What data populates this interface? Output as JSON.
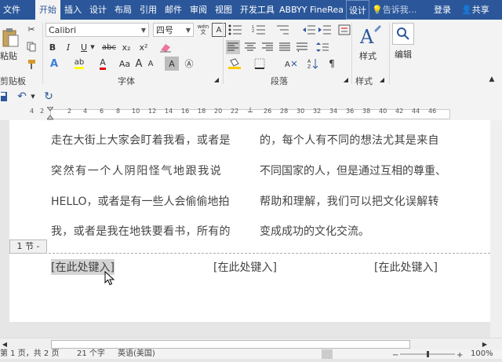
{
  "tabs": [
    {
      "label": "文件"
    },
    {
      "label": "开始"
    },
    {
      "label": "插入"
    },
    {
      "label": "设计"
    },
    {
      "label": "布局"
    },
    {
      "label": "引用"
    },
    {
      "label": "邮件"
    },
    {
      "label": "审阅"
    },
    {
      "label": "视图"
    },
    {
      "label": "开发工具"
    },
    {
      "label": "ABBYY FineRea"
    },
    {
      "label": "设计"
    }
  ],
  "tell_me": "告诉我...",
  "login": "登录",
  "share": "共享",
  "ribbon": {
    "paste_label": "粘贴",
    "clipboard_label": "剪贴板",
    "font_name": "Calibri",
    "font_size": "四号",
    "wen_label": "wén",
    "font_group_label": "字体",
    "paragraph_group_label": "段落",
    "styles_label": "样式",
    "styles_group_label": "样式",
    "edit_label": "编辑",
    "clear_format_a": "A",
    "aa_label": "Aa",
    "a_big": "A",
    "a_small": "A",
    "bold": "B",
    "italic": "I",
    "underline": "U",
    "strike": "abc",
    "sub": "x₂",
    "sup": "x²",
    "char_border": "A",
    "highlight": "ab",
    "font_color": "A",
    "char_shade": "A",
    "circle_char": "Ⓐ"
  },
  "accent_colors": {
    "highlight": "#ffff00",
    "font_color": "#e00000",
    "brand": "#2b579a"
  },
  "ruler_numbers": [
    "4",
    "2",
    "",
    "2",
    "4",
    "6",
    "8",
    "10",
    "12",
    "14",
    "16",
    "18",
    "20",
    "22",
    "24",
    "26",
    "28",
    "30",
    "32",
    "34",
    "36",
    "38",
    "40",
    "42",
    "44",
    "46"
  ],
  "document": {
    "lines": [
      "走在大街上大家会盯着我看，或者是",
      "突然有一个人阴阳怪气地跟我说",
      "HELLO，或者是有一些人会偷偷地拍",
      "我，或者是我在地铁要看书，所有的"
    ],
    "lines_right": [
      "的，每个人有不同的想法尤其是来自",
      "不同国家的人，但是通过互相的尊重、",
      "帮助和理解，我们可以把文化误解转",
      "变成成功的文化交流。"
    ],
    "section_tag": "1 节 -",
    "placeholders": [
      "[在此处键入]",
      "[在此处键入]",
      "[在此处键入]"
    ]
  },
  "status": {
    "page": "第 1 页，共 2 页",
    "words": "21 个字",
    "language": "英语(美国)",
    "zoom": "100%"
  }
}
